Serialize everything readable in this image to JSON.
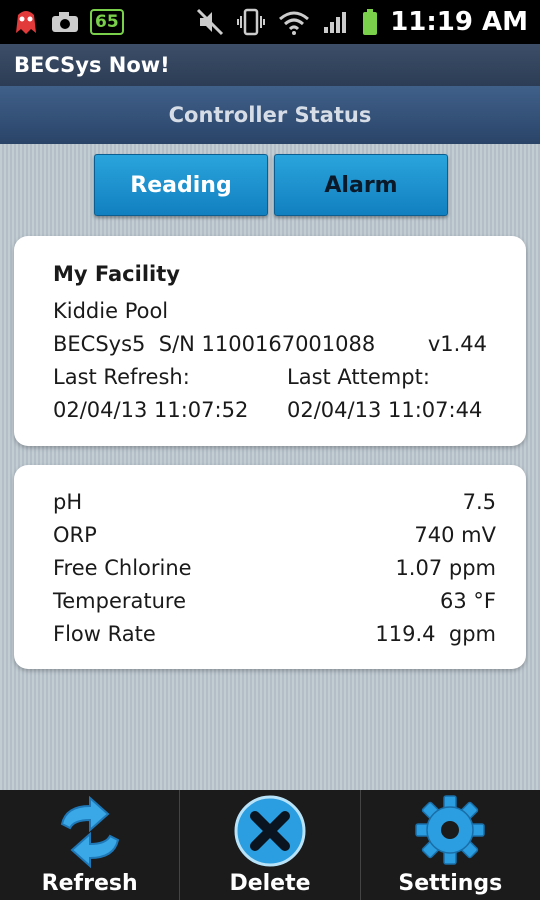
{
  "status_bar": {
    "battery_badge": "65",
    "time": "11:19 AM",
    "icons": [
      "app-notification-icon",
      "camera-icon",
      "mute-icon",
      "vibrate-icon",
      "wifi-icon",
      "signal-icon",
      "battery-icon"
    ]
  },
  "app": {
    "title": "BECSys Now!",
    "screen_title": "Controller Status"
  },
  "tabs": [
    {
      "label": "Reading",
      "selected": true
    },
    {
      "label": "Alarm",
      "selected": false
    }
  ],
  "facility": {
    "name": "My Facility",
    "pool": "Kiddie Pool",
    "device": "BECSys5  S/N 1100167001088",
    "version": "v1.44",
    "last_refresh_label": "Last Refresh:",
    "last_attempt_label": "Last Attempt:",
    "last_refresh_value": "02/04/13 11:07:52",
    "last_attempt_value": "02/04/13 11:07:44"
  },
  "readings": [
    {
      "label": "pH",
      "value": "7.5"
    },
    {
      "label": "ORP",
      "value": "740 mV"
    },
    {
      "label": "Free Chlorine",
      "value": "1.07 ppm"
    },
    {
      "label": "Temperature",
      "value": "63 °F"
    },
    {
      "label": "Flow Rate",
      "value": "119.4  gpm"
    }
  ],
  "bottom_bar": {
    "refresh_label": "Refresh",
    "delete_label": "Delete",
    "settings_label": "Settings"
  },
  "colors": {
    "accent_blue": "#1a8fd0",
    "title_bar": "#2c3c55",
    "bottom_bar": "#1b1b1b"
  }
}
